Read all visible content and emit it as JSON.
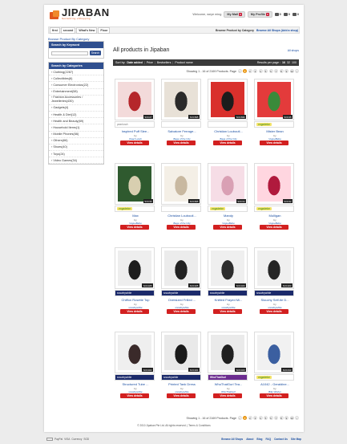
{
  "header": {
    "logo": "JIPABAN",
    "tagline": "Socializing eShopping",
    "welcome": "Welcome, weye ming",
    "my_mall": "My Mall",
    "my_mall_badge": "0",
    "my_profile": "My Profile",
    "my_profile_badge": "0",
    "cart_1": "0",
    "cart_2": "0",
    "cart_3": "0"
  },
  "menubar": {
    "items": [
      "first",
      "second",
      "What's New",
      "Floor"
    ],
    "browse_category": "Browse Product by Category",
    "browse_shops": "Browse All Shops (Add a shop)"
  },
  "sidebar": {
    "browse_title": "Browse Product By Category",
    "keyword_head": "Search by Keyword",
    "search_btn": "Search",
    "cat_head": "Search by Categories",
    "categories": [
      "Clothing(2287)",
      "Collectibles(6)",
      "Consumer Electronics(22)",
      "Entertainment(58)",
      "Fashion Accessories / Jewelleries(430)",
      "Gadgets(4)",
      "Health & Diet(12)",
      "Health and Beauty(69)",
      "Household Items(1)",
      "Mobile Phones(66)",
      "Others(66)",
      "Shoes(40)",
      "Toys(24)",
      "Video Games(34)"
    ]
  },
  "main": {
    "title": "All products in Jipaban",
    "all_shops": "All shops",
    "sort_label": "Sort by:",
    "sort_options": [
      "Date added",
      "Price",
      "Bestsellers",
      "Product name"
    ],
    "results_label": "Results per page :",
    "results_options": [
      "16",
      "32",
      "100"
    ],
    "pager_text": "Showing 1 - 16 of 2169 Products. Page",
    "pages": [
      "1",
      "2",
      "3",
      "4",
      "5",
      "6",
      "7",
      "8",
      "9",
      "10"
    ],
    "copyright": "© 2010 Jipaban Pte Ltd. All rights reserved. | Terms & Conditions"
  },
  "products": [
    {
      "name": "Inspired Puff Slee...",
      "shop": "Pearl Lurah",
      "code": "SOC27",
      "brand": "pearlurah"
    },
    {
      "name": "Salvatore Ferrage...",
      "shop": "Bags of the City",
      "code": "SOC695",
      "brand": ""
    },
    {
      "name": "Christian Louboutl...",
      "shop": "Bags of the City",
      "code": "SOC696",
      "brand": ""
    },
    {
      "name": "Mister Bean",
      "shop": "VogueBebe",
      "code": "SOC35",
      "brand": "vogabebe"
    },
    {
      "name": "Max",
      "shop": "VogueBebe",
      "code": "SOC36",
      "brand": "vogabebe"
    },
    {
      "name": "Christian Louboutl...",
      "shop": "Bags of the City",
      "code": "SOC695",
      "brand": ""
    },
    {
      "name": "Mandy",
      "shop": "VogueBebe",
      "code": "SOC34",
      "brand": "vogabebe"
    },
    {
      "name": "Mulligan",
      "shop": "VogueBebe",
      "code": "SOC32",
      "brand": "vogabebe"
    },
    {
      "name": "Chiffon Rosette Top",
      "shop": "snowbywhite",
      "code": "SOC325",
      "brand": "snowbywhite"
    },
    {
      "name": "Oversized Frilled ...",
      "shop": "snowbywhite",
      "code": "SOC325",
      "brand": "snowbywhite"
    },
    {
      "name": "Knitted Frayed Mi...",
      "shop": "snowbywhite",
      "code": "SOC323",
      "brand": "snowbywhite"
    },
    {
      "name": "Slouchy Self-tie D...",
      "shop": "snowbywhite",
      "code": "SOC323",
      "brand": "snowbywhite"
    },
    {
      "name": "Structured Tube ...",
      "shop": "snowbywhite",
      "code": "SOC322",
      "brand": "snowbywhite"
    },
    {
      "name": "Printed Tank Dress",
      "shop": "snowbywhite",
      "code": "SOC321",
      "brand": "snowbywhite"
    },
    {
      "name": "WhoThatGurl Tea...",
      "shop": "WhoThatGurl",
      "code": "SOC320",
      "brand": "WhoThatGurl"
    },
    {
      "name": "A1042 - Geraldine...",
      "shop": "Billy Wisher",
      "code": "SOC313",
      "brand": "vogabebe"
    }
  ],
  "card_labels": {
    "by": "by",
    "view": "View details"
  },
  "bottom": {
    "currency": "Currency",
    "currency_value": "SGD",
    "links": [
      "Browse All Shops",
      "About",
      "Blog",
      "FAQ",
      "Contact Us",
      "Site Map"
    ],
    "pay": [
      "PayPal",
      "VISA"
    ]
  },
  "colors": {
    "accent": "#e0571d",
    "nav": "#2f4f8f",
    "button": "#d22020",
    "page_active": "#f5a623"
  }
}
